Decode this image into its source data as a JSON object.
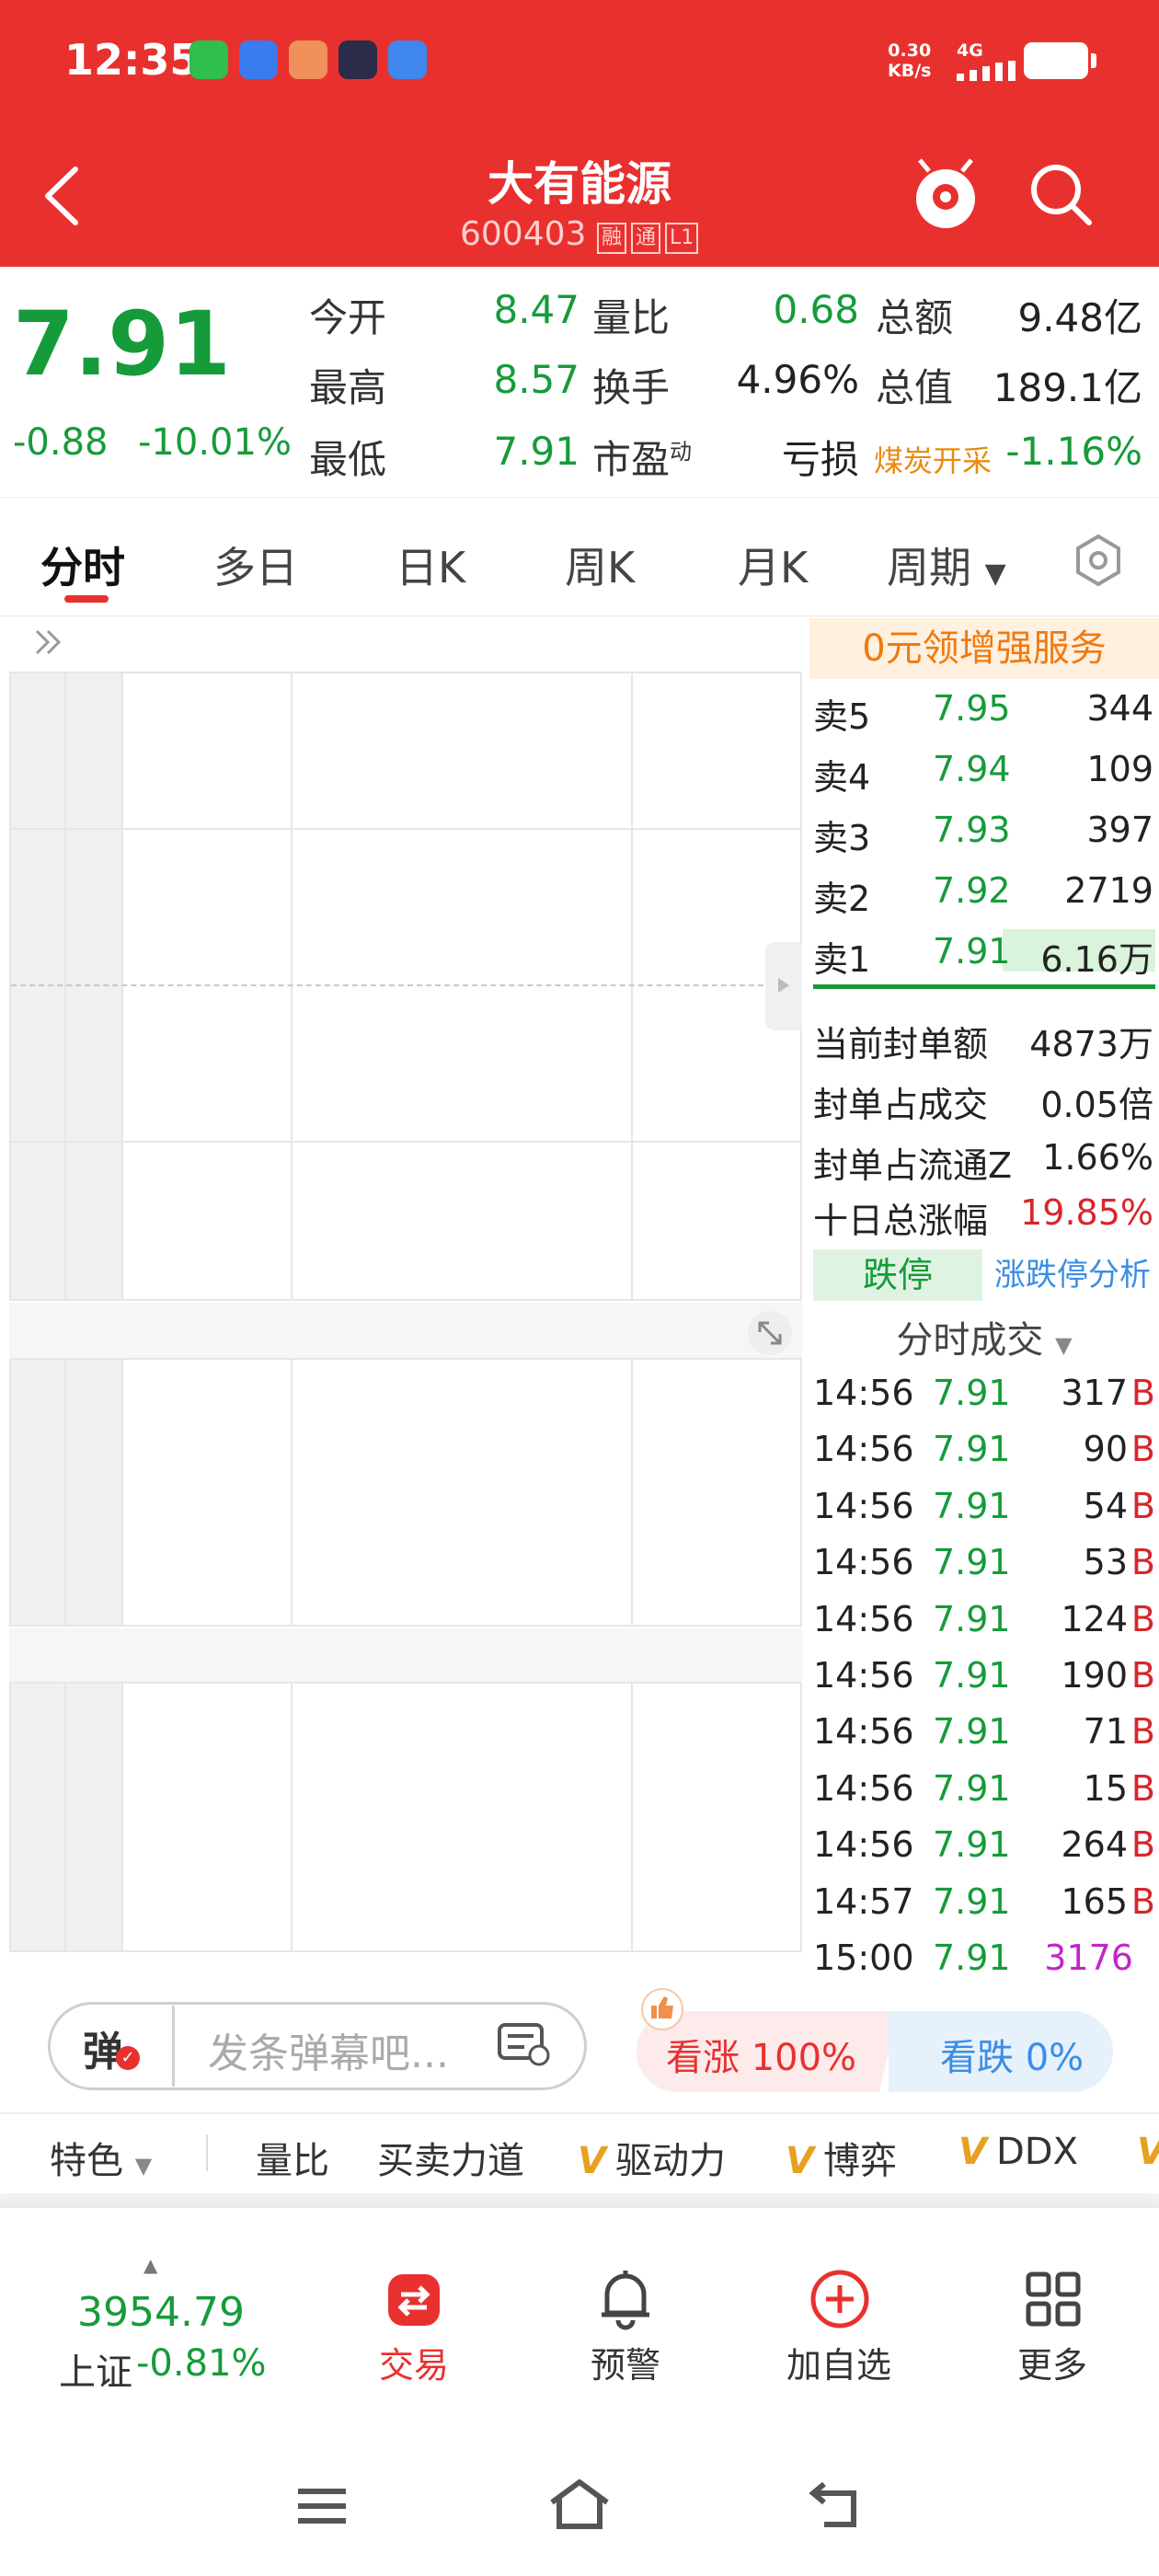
{
  "status_bar": {
    "time": "12:35",
    "net_speed": "0.30",
    "net_unit": "KB/s",
    "network": "4G"
  },
  "header": {
    "title": "大有能源",
    "code": "600403",
    "tags": [
      "融",
      "通",
      "L1"
    ]
  },
  "quote": {
    "price": "7.91",
    "change": "-0.88",
    "change_pct": "-10.01%",
    "stats": [
      {
        "label": "今开",
        "value": "8.47"
      },
      {
        "label": "量比",
        "value": "0.68"
      },
      {
        "label": "总额",
        "value": "9.48亿"
      },
      {
        "label": "最高",
        "value": "8.57"
      },
      {
        "label": "换手",
        "value": "4.96%"
      },
      {
        "label": "总值",
        "value": "189.1亿"
      },
      {
        "label": "最低",
        "value": "7.91"
      },
      {
        "label": "市盈",
        "sup": "动",
        "value": "亏损"
      },
      {
        "label": "煤炭开采",
        "value": "-1.16%"
      }
    ]
  },
  "tabs": [
    "分时",
    "多日",
    "日K",
    "周K",
    "月K",
    "周期"
  ],
  "order_book": {
    "promo": "0元领增强服务",
    "asks": [
      {
        "label": "卖5",
        "price": "7.95",
        "vol": "344"
      },
      {
        "label": "卖4",
        "price": "7.94",
        "vol": "109"
      },
      {
        "label": "卖3",
        "price": "7.93",
        "vol": "397"
      },
      {
        "label": "卖2",
        "price": "7.92",
        "vol": "2719"
      },
      {
        "label": "卖1",
        "price": "7.91",
        "vol": "6.16万"
      }
    ],
    "seal": [
      {
        "label": "当前封单额",
        "value": "4873万"
      },
      {
        "label": "封单占成交",
        "value": "0.05倍"
      },
      {
        "label": "封单占流通Z",
        "value": "1.66%"
      },
      {
        "label": "十日总涨幅",
        "value": "19.85%"
      }
    ],
    "limit_badge": "跌停",
    "limit_link": "涨跌停分析",
    "ticks_title": "分时成交",
    "ticks": [
      {
        "time": "14:56",
        "price": "7.91",
        "vol": "317",
        "side": "B"
      },
      {
        "time": "14:56",
        "price": "7.91",
        "vol": "90",
        "side": "B"
      },
      {
        "time": "14:56",
        "price": "7.91",
        "vol": "54",
        "side": "B"
      },
      {
        "time": "14:56",
        "price": "7.91",
        "vol": "53",
        "side": "B"
      },
      {
        "time": "14:56",
        "price": "7.91",
        "vol": "124",
        "side": "B"
      },
      {
        "time": "14:56",
        "price": "7.91",
        "vol": "190",
        "side": "B"
      },
      {
        "time": "14:56",
        "price": "7.91",
        "vol": "71",
        "side": "B"
      },
      {
        "time": "14:56",
        "price": "7.91",
        "vol": "15",
        "side": "B"
      },
      {
        "time": "14:56",
        "price": "7.91",
        "vol": "264",
        "side": "B"
      },
      {
        "time": "14:57",
        "price": "7.91",
        "vol": "165",
        "side": "B"
      },
      {
        "time": "15:00",
        "price": "7.91",
        "vol": "3176",
        "side": ""
      }
    ]
  },
  "danmaku": {
    "toggle": "弹",
    "placeholder": "发条弹幕吧...",
    "up_vote": "看涨 100%",
    "down_vote": "看跌 0%"
  },
  "categories": [
    "特色",
    "量比",
    "买卖力道",
    "驱动力",
    "博弈",
    "DDX"
  ],
  "bottom_bar": {
    "index_value": "3954.79",
    "index_name": "上证",
    "index_change": "-0.81%",
    "items": [
      "交易",
      "预警",
      "加自选",
      "更多"
    ]
  },
  "colors": {
    "brand": "#e8312f",
    "down": "#169b3a",
    "up": "#d8262a"
  }
}
